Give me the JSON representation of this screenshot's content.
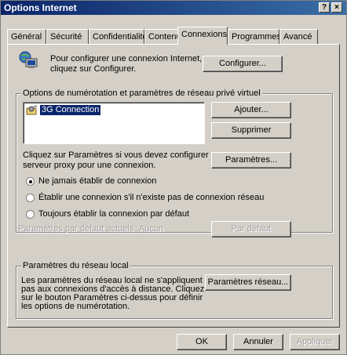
{
  "window": {
    "title": "Options Internet",
    "help_btn": "?",
    "close_btn": "×"
  },
  "tabs": [
    {
      "label": "Général"
    },
    {
      "label": "Sécurité"
    },
    {
      "label": "Confidentialité"
    },
    {
      "label": "Contenu"
    },
    {
      "label": "Connexions"
    },
    {
      "label": "Programmes"
    },
    {
      "label": "Avancé"
    }
  ],
  "setup": {
    "text_line1": "Pour configurer une connexion Internet,",
    "text_line2": "cliquez sur Configurer.",
    "button": "Configurer..."
  },
  "dialup": {
    "group_label": "Options de numérotation et paramètres de réseau privé virtuel",
    "connection": "3G Connection",
    "add_button": "Ajouter...",
    "remove_button": "Supprimer",
    "proxy_line1": "Cliquez sur Paramètres si vous devez configurer un",
    "proxy_line2": "serveur proxy pour une connexion.",
    "settings_button": "Paramètres...",
    "radio_never": "Ne jamais établir de connexion",
    "radio_when_none": "Établir une connexion s'il n'existe pas de connexion réseau",
    "radio_always": "Toujours établir la connexion par défaut",
    "selected_radio": "never",
    "default_label": "Paramètres par défaut actuels :",
    "default_value": "Aucun",
    "default_button": "Par défaut"
  },
  "lan": {
    "group_label": "Paramètres du réseau local",
    "line1": "Les paramètres du réseau local ne s'appliquent",
    "line2": "pas aux connexions d'accès à distance. Cliquez",
    "line3": "sur le bouton Paramètres ci-dessus pour définir",
    "line4": "les options de numérotation.",
    "button": "Paramètres réseau..."
  },
  "footer": {
    "ok": "OK",
    "cancel": "Annuler",
    "apply": "Appliquer"
  }
}
